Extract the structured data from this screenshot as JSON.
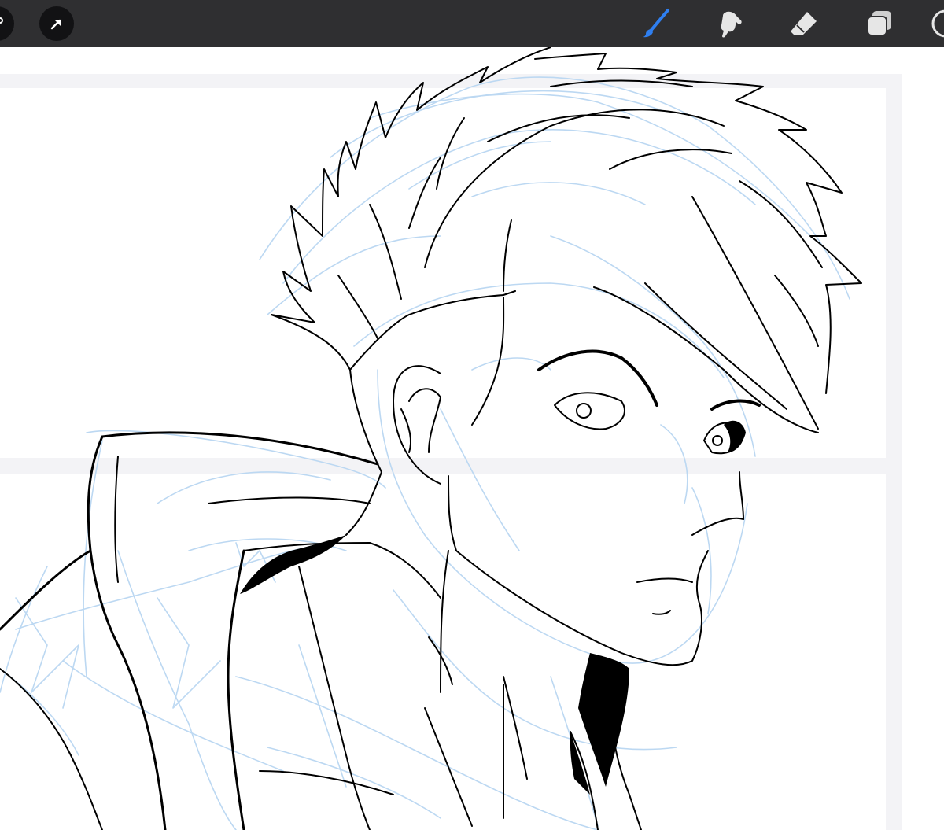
{
  "app": {
    "accent_color": "#2f7ff0",
    "toolbar_color": "#2f2f31"
  },
  "toolbar": {
    "left_tools": [
      {
        "icon": "wrench-icon"
      },
      {
        "icon": "selection-arrow-icon"
      }
    ],
    "right_tools": [
      {
        "icon": "brush-icon",
        "active": true
      },
      {
        "icon": "smudge-icon",
        "active": false
      },
      {
        "icon": "eraser-icon",
        "active": false
      },
      {
        "icon": "layers-icon",
        "active": false
      },
      {
        "icon": "color-picker-icon",
        "active": false
      }
    ]
  },
  "canvas": {
    "content": "line-art-sketch",
    "sketch_color": "#bcd8f2",
    "ink_color": "#000000",
    "panel_border_color": "#f3f3f6"
  }
}
